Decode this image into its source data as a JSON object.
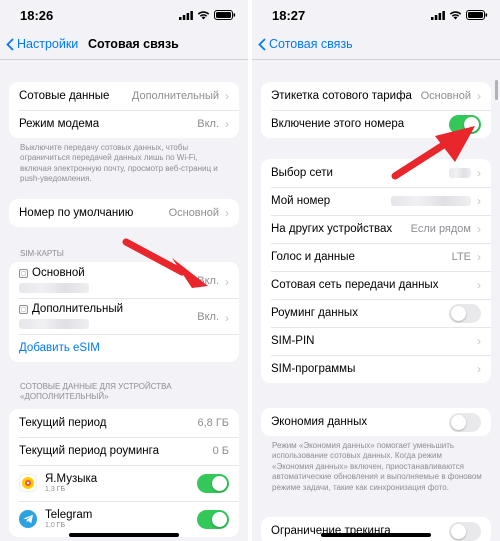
{
  "left": {
    "status": {
      "time": "18:26"
    },
    "nav": {
      "back_label": "Настройки",
      "title": "Сотовая связь"
    },
    "group1": {
      "rows": [
        {
          "label": "Сотовые данные",
          "value": "Дополнительный"
        },
        {
          "label": "Режим модема",
          "value": "Вкл."
        }
      ]
    },
    "caption1": "Выключите передачу сотовых данных, чтобы ограничиться передачей данных лишь по Wi-Fi, включая электронную почту, просмотр веб-страниц и push-уведомления.",
    "group2": {
      "label": "Номер по умолчанию",
      "value": "Основной"
    },
    "sim_header": "SIM-КАРТЫ",
    "sims": [
      {
        "label": "Основной",
        "value": "Вкл."
      },
      {
        "label": "Дополнительный",
        "value": "Вкл."
      }
    ],
    "add_esim": "Добавить eSIM",
    "data_header": "СОТОВЫЕ ДАННЫЕ ДЛЯ УСТРОЙСТВА «ДОПОЛНИТЕЛЬНЫЙ»",
    "usage": [
      {
        "label": "Текущий период",
        "value": "6,8 ГБ"
      },
      {
        "label": "Текущий период роуминга",
        "value": "0 Б"
      }
    ],
    "apps": [
      {
        "name": "Я.Музыка",
        "size": "1,3 ГБ",
        "enabled": true
      },
      {
        "name": "Telegram",
        "size": "1,0 ГБ",
        "enabled": true
      }
    ]
  },
  "right": {
    "status": {
      "time": "18:27"
    },
    "nav": {
      "back_label": "Сотовая связь"
    },
    "group1": {
      "tariff_label": {
        "label": "Этикетка сотового тарифа",
        "value": "Основной"
      },
      "line_toggle": {
        "label": "Включение этого номера",
        "enabled": true
      }
    },
    "group2": {
      "rows": [
        {
          "label": "Выбор сети",
          "value": ""
        },
        {
          "label": "Мой номер",
          "value": ""
        },
        {
          "label": "На других устройствах",
          "value": "Если рядом"
        },
        {
          "label": "Голос и данные",
          "value": "LTE"
        },
        {
          "label": "Сотовая сеть передачи данных",
          "value": ""
        },
        {
          "label": "Роуминг данных",
          "toggle": false
        },
        {
          "label": "SIM-PIN",
          "value": ""
        },
        {
          "label": "SIM-программы",
          "value": ""
        }
      ]
    },
    "data_saver": {
      "label": "Экономия данных",
      "enabled": false
    },
    "caption": "Режим «Экономия данных» помогает уменьшить использование сотовых данных. Когда режим «Экономия данных» включен, приостанавливаются автоматические обновления и выполняемые в фоновом режиме задачи, такие как синхронизация фото.",
    "tracking": {
      "label": "Ограничение трекинга"
    }
  },
  "colors": {
    "accent": "#007aff",
    "toggle_on": "#34c759",
    "arrow": "#e8262b"
  }
}
